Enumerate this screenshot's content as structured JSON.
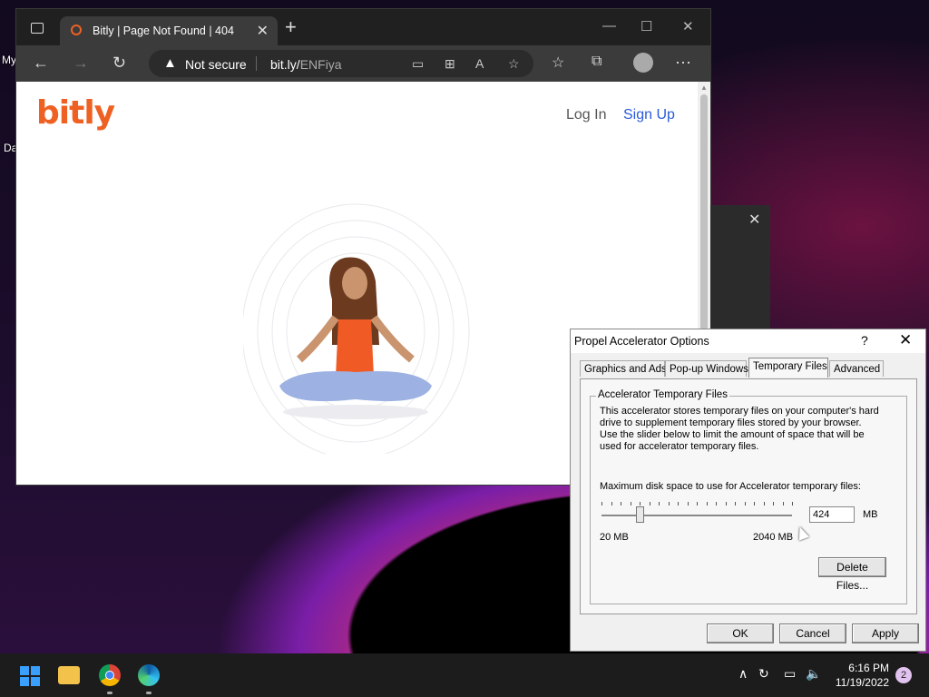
{
  "desktop": {
    "label_1": "My",
    "label_2": "Da"
  },
  "browser": {
    "tab_title": "Bitly | Page Not Found | 404",
    "tab_close": "✕",
    "new_tab": "+",
    "security_label": "Not secure",
    "url_host": "bit.ly/",
    "url_path": "ENFiya"
  },
  "page": {
    "logo": "bitly",
    "login": "Log In",
    "signup": "Sign Up"
  },
  "dialog": {
    "title": "Propel Accelerator Options",
    "help": "?",
    "close": "✕",
    "tabs": [
      "Graphics and Ads",
      "Pop-up Windows",
      "Temporary Files",
      "Advanced"
    ],
    "active_tab": "Temporary Files",
    "group_label": "Accelerator Temporary Files",
    "description": "This accelerator stores temporary files on your computer's hard drive to supplement temporary files stored by your browser. Use the slider below to limit the amount of space that will be used for accelerator temporary files.",
    "max_label": "Maximum disk space to use for Accelerator temporary files:",
    "slider_min_label": "20 MB",
    "slider_max_label": "2040 MB",
    "slider_min": 20,
    "slider_max": 2040,
    "slider_value": 424,
    "mb_value": "424",
    "mb_unit": "MB",
    "delete_button": "Delete Files...",
    "ok_button": "OK",
    "cancel_button": "Cancel",
    "apply_button": "Apply"
  },
  "taskbar": {
    "time": "6:16 PM",
    "date": "11/19/2022",
    "notification_count": "2"
  }
}
